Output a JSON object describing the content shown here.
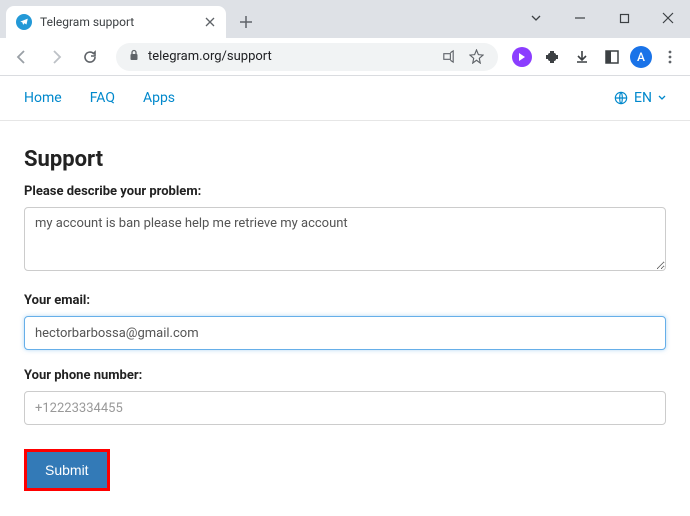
{
  "browser": {
    "tab": {
      "title": "Telegram support"
    },
    "url": "telegram.org/support",
    "avatar_letter": "A"
  },
  "site_nav": {
    "home": "Home",
    "faq": "FAQ",
    "apps": "Apps",
    "lang": "EN"
  },
  "page": {
    "title": "Support",
    "problem_label": "Please describe your problem:",
    "problem_value": "my account is ban please help me retrieve my account",
    "email_label": "Your email:",
    "email_value": "hectorbarbossa@gmail.com",
    "phone_label": "Your phone number:",
    "phone_placeholder": "+12223334455",
    "submit_label": "Submit"
  }
}
